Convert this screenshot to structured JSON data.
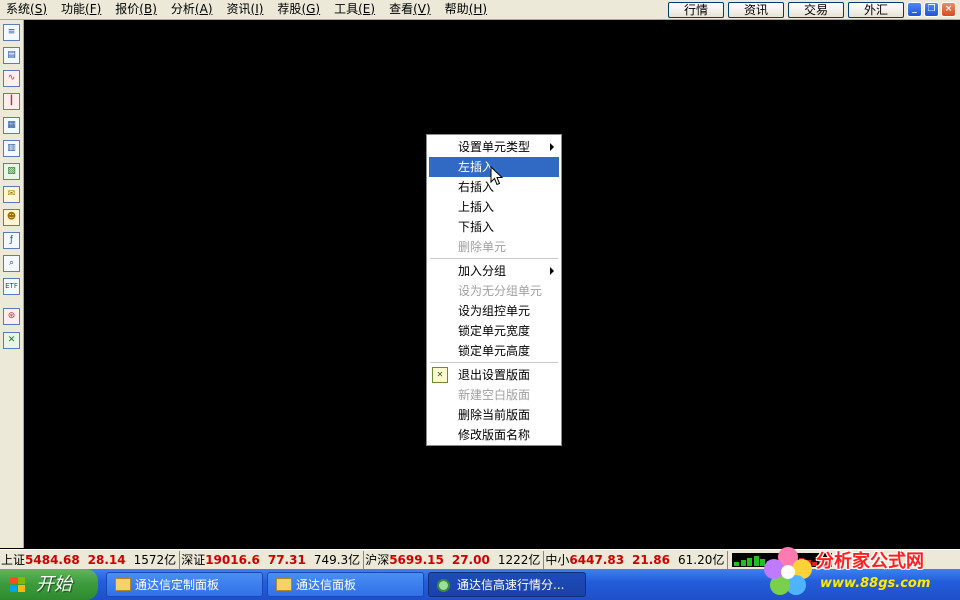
{
  "menubar": {
    "items": [
      {
        "label": "系统",
        "key": "(S)"
      },
      {
        "label": "功能",
        "key": "(F)"
      },
      {
        "label": "报价",
        "key": "(B)"
      },
      {
        "label": "分析",
        "key": "(A)"
      },
      {
        "label": "资讯",
        "key": "(I)"
      },
      {
        "label": "荐股",
        "key": "(G)"
      },
      {
        "label": "工具",
        "key": "(E)"
      },
      {
        "label": "查看",
        "key": "(V)"
      },
      {
        "label": "帮助",
        "key": "(H)"
      }
    ],
    "quick_buttons": [
      "行情",
      "资讯",
      "交易",
      "外汇"
    ],
    "window_controls": {
      "minimize": "_",
      "restore": "❐",
      "close": "×"
    }
  },
  "left_toolbar": {
    "icons": [
      {
        "name": "report-icon",
        "glyph": "≡"
      },
      {
        "name": "quote-list-icon",
        "glyph": "▤"
      },
      {
        "name": "line-chart-icon",
        "glyph": "∿"
      },
      {
        "name": "candlestick-icon",
        "glyph": "┃"
      },
      {
        "name": "window-list-icon",
        "glyph": "▦"
      },
      {
        "name": "table-icon",
        "glyph": "▥"
      },
      {
        "name": "document-icon",
        "glyph": "▧"
      },
      {
        "name": "mail-icon",
        "glyph": "✉"
      },
      {
        "name": "users-icon",
        "glyph": "☻"
      },
      {
        "name": "formula-icon",
        "glyph": "ƒ"
      },
      {
        "name": "search-icon",
        "glyph": "⌕"
      },
      {
        "name": "etf-icon",
        "glyph": "ETF"
      },
      {
        "name": "link-icon",
        "glyph": "⊛"
      },
      {
        "name": "layout-icon",
        "glyph": "✕"
      }
    ]
  },
  "context_menu": {
    "groups": [
      [
        {
          "label": "设置单元类型",
          "submenu": true
        },
        {
          "label": "左插入",
          "selected": true
        },
        {
          "label": "右插入"
        },
        {
          "label": "上插入"
        },
        {
          "label": "下插入"
        },
        {
          "label": "删除单元",
          "disabled": true
        }
      ],
      [
        {
          "label": "加入分组",
          "submenu": true
        },
        {
          "label": "设为无分组单元",
          "disabled": true
        },
        {
          "label": "设为组控单元"
        },
        {
          "label": "锁定单元宽度"
        },
        {
          "label": "锁定单元高度"
        }
      ],
      [
        {
          "label": "退出设置版面",
          "icon": "layout-icon"
        },
        {
          "label": "新建空白版面",
          "disabled": true
        },
        {
          "label": "删除当前版面"
        },
        {
          "label": "修改版面名称"
        }
      ]
    ]
  },
  "statusbar": {
    "segments": [
      {
        "name": "上证",
        "index": "5484.68",
        "change": "28.14",
        "amount": "1572亿"
      },
      {
        "name": "深证",
        "index": "19016.6",
        "change": "77.31",
        "amount": "749.3亿"
      },
      {
        "name": "沪深",
        "index": "5699.15",
        "change": "27.00",
        "amount": "1222亿"
      },
      {
        "name": "中小",
        "index": "6447.83",
        "change": "21.86",
        "amount": "61.20亿"
      }
    ]
  },
  "taskbar": {
    "start_label": "开始",
    "tasks": [
      {
        "label": "通达信定制面板",
        "active": false
      },
      {
        "label": "通达信面板",
        "active": false
      },
      {
        "label": "通达信高速行情分...",
        "active": true
      }
    ]
  },
  "watermark": {
    "title": "分析家公式网",
    "url": "www.88gs.com"
  },
  "colors": {
    "menu_bg": "#ECE9D8",
    "selection": "#316AC5",
    "price_up": "#D00000",
    "taskbar": "#245EDB",
    "start_green": "#3C9A3C"
  }
}
